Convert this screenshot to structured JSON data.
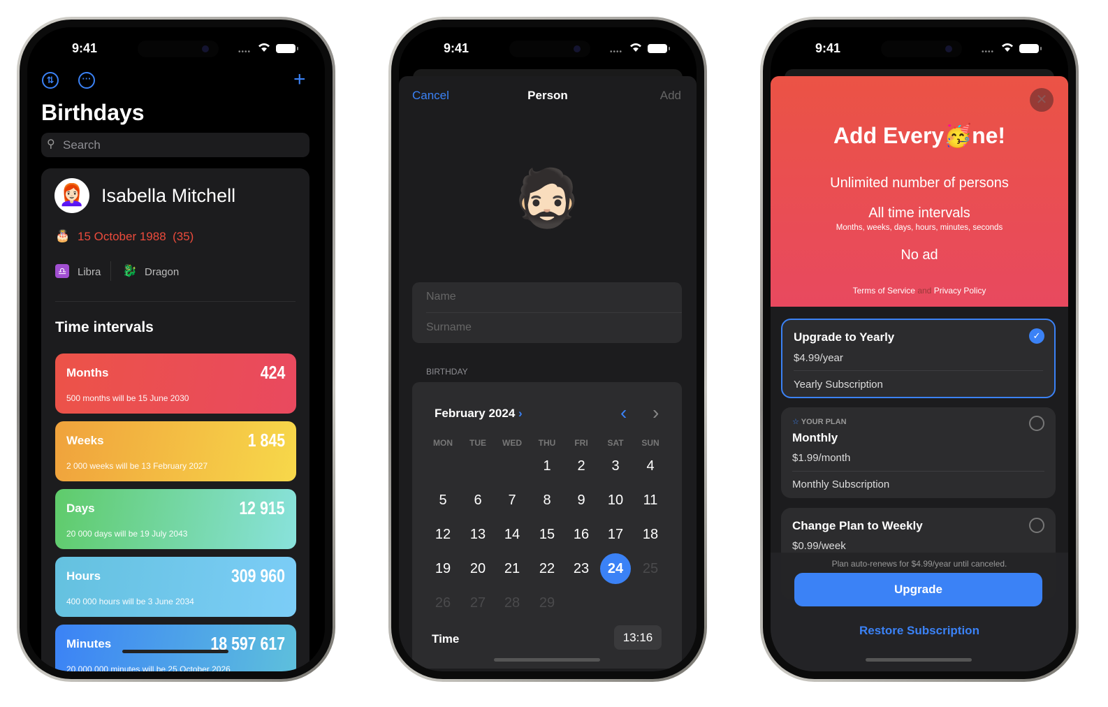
{
  "status": {
    "time": "9:41"
  },
  "birthdays": {
    "title": "Birthdays",
    "search_placeholder": "Search",
    "person": {
      "name": "Isabella Mitchell",
      "birthdate": "15 October 1988",
      "age": "(35)",
      "zodiac": "Libra",
      "chinese_zodiac": "Dragon",
      "avatar_emoji": "👩🏻‍🦰"
    },
    "section_title": "Time intervals",
    "intervals": [
      {
        "label": "Months",
        "value": "424",
        "note": "500 months will be 15 June 2030",
        "colors": [
          "#ec5348",
          "#e9495f"
        ]
      },
      {
        "label": "Weeks",
        "value": "1 845",
        "note": "2 000 weeks will be 13 February 2027",
        "colors": [
          "#f0a23c",
          "#f7d84a"
        ]
      },
      {
        "label": "Days",
        "value": "12 915",
        "note": "20 000 days will be 19 July 2043",
        "colors": [
          "#5fcb6a",
          "#89e2dc"
        ]
      },
      {
        "label": "Hours",
        "value": "309 960",
        "note": "400 000 hours will be 3 June 2034",
        "colors": [
          "#64c1df",
          "#7ccdf7"
        ]
      },
      {
        "label": "Minutes",
        "value": "18 597 617",
        "note": "20 000 000 minutes will be 25 October 2026",
        "colors": [
          "#3b82f6",
          "#5ec0dc"
        ]
      }
    ]
  },
  "person_form": {
    "cancel": "Cancel",
    "title": "Person",
    "add": "Add",
    "avatar_emoji": "🧔🏻",
    "name_placeholder": "Name",
    "surname_placeholder": "Surname",
    "birthday_label": "BIRTHDAY",
    "month": "February 2024",
    "weekdays": [
      "MON",
      "TUE",
      "WED",
      "THU",
      "FRI",
      "SAT",
      "SUN"
    ],
    "first_weekday_index": 3,
    "days_in_month": 29,
    "selected_day": 24,
    "max_day": 24,
    "time_label": "Time",
    "time_value": "13:16"
  },
  "paywall": {
    "title_before": "Add Every",
    "title_emoji": "🥳",
    "title_after": "ne!",
    "feature1": "Unlimited number of persons",
    "feature2": "All time intervals",
    "feature2_sub": "Months, weeks, days, hours, minutes, seconds",
    "feature3": "No ad",
    "terms": "Terms of Service",
    "and": "and",
    "privacy": "Privacy Policy",
    "plans": [
      {
        "title": "Upgrade to Yearly",
        "price": "$4.99/year",
        "desc": "Yearly Subscription",
        "selected": true
      },
      {
        "badge": "YOUR PLAN",
        "title": "Monthly",
        "price": "$1.99/month",
        "desc": "Monthly Subscription",
        "selected": false
      },
      {
        "title": "Change Plan to Weekly",
        "price": "$0.99/week",
        "selected": false
      }
    ],
    "renew_note": "Plan auto-renews for $4.99/year until canceled.",
    "upgrade": "Upgrade",
    "restore": "Restore Subscription",
    "accent": "#3b82f6"
  }
}
